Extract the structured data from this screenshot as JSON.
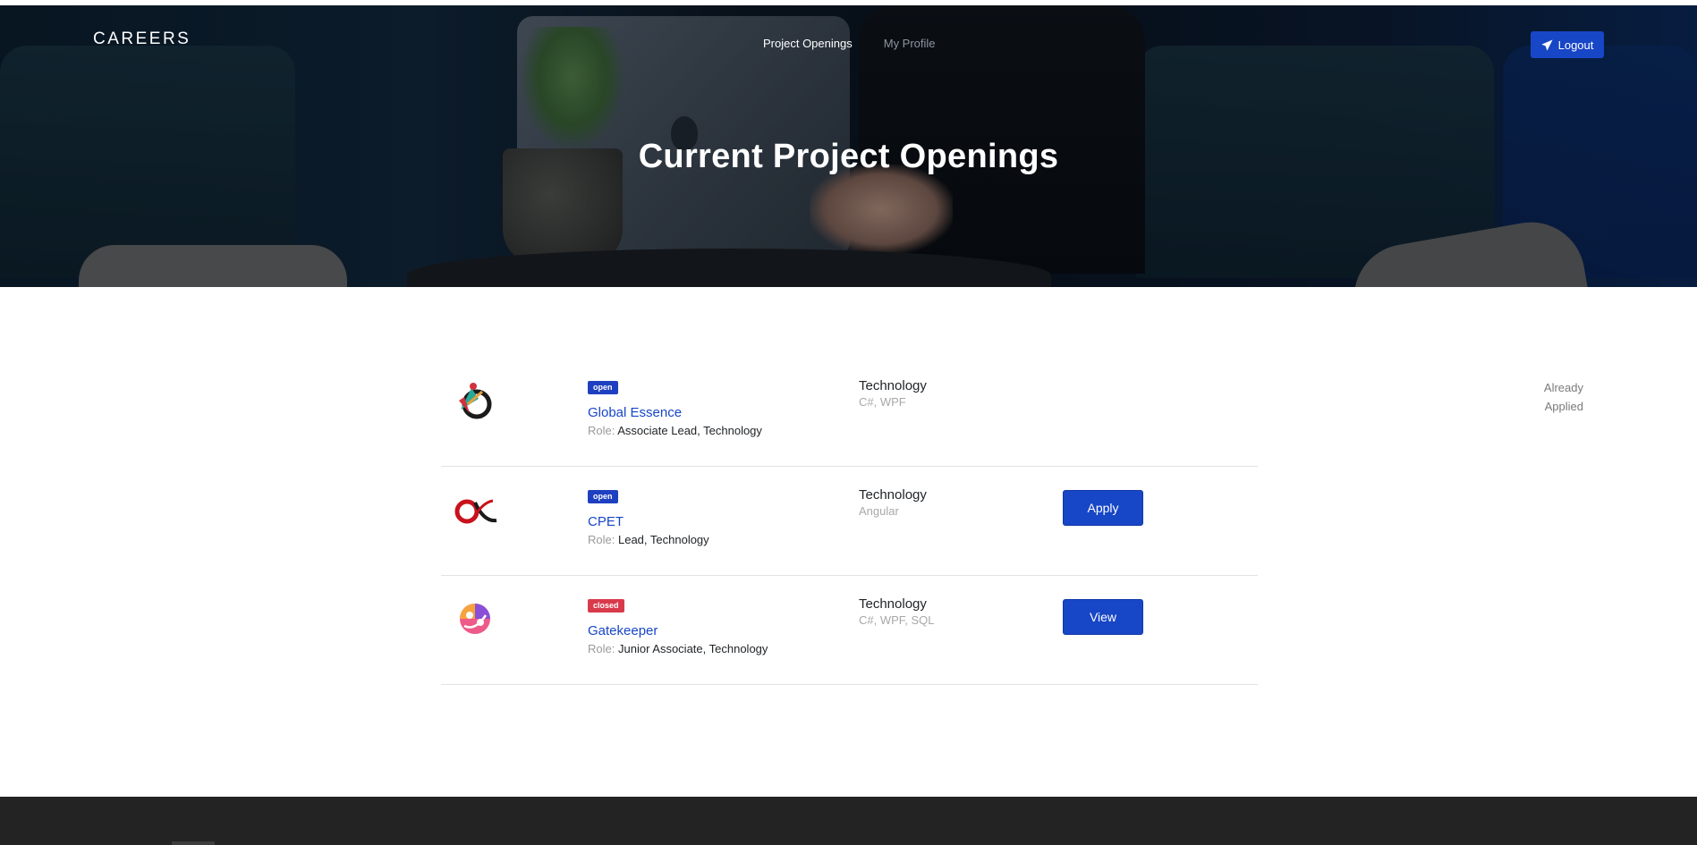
{
  "nav": {
    "brand": "CAREERS",
    "links": [
      "Project Openings",
      "My Profile"
    ],
    "logout_label": "Logout"
  },
  "hero": {
    "title": "Current Project Openings"
  },
  "projects": [
    {
      "status": "open",
      "name": "Global Essence",
      "role_label": "Role:",
      "role": "Associate Lead, Technology",
      "department": "Technology",
      "tech": "C#, WPF",
      "action": "Already Applied",
      "action_lines": [
        "Already",
        "Applied"
      ]
    },
    {
      "status": "open",
      "name": "CPET",
      "role_label": "Role:",
      "role": "Lead, Technology",
      "department": "Technology",
      "tech": "Angular",
      "action": "Apply"
    },
    {
      "status": "closed",
      "name": "Gatekeeper",
      "role_label": "Role:",
      "role": "Junior Associate, Technology",
      "department": "Technology",
      "tech": "C#, WPF, SQL",
      "action": "View"
    }
  ],
  "colors": {
    "accent": "#1746c6",
    "badge_open": "#1e40c0",
    "badge_closed": "#d93a4b",
    "footer": "#232323"
  },
  "icons": {
    "logout": "paper-plane-icon"
  }
}
